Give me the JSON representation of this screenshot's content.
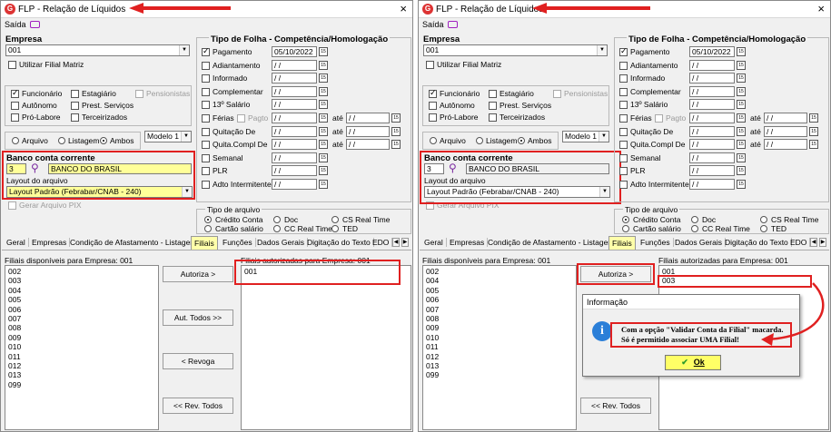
{
  "app": {
    "icon_letter": "G",
    "title": "FLP - Relação de Líquidos",
    "close": "×"
  },
  "menu": {
    "saida": "Saída"
  },
  "empresa": {
    "label": "Empresa",
    "value": "001",
    "filial_matriz": "Utilizar Filial Matriz"
  },
  "categorias": {
    "funcionario": "Funcionário",
    "estagiario": "Estagiário",
    "pensionistas": "Pensionistas",
    "autonomo": "Autônomo",
    "prest_servicos": "Prest. Serviços",
    "pro_labore": "Pró-Labore",
    "terceirizados": "Terceirizados"
  },
  "saida": {
    "arquivo": "Arquivo",
    "listagem": "Listagem",
    "ambos": "Ambos",
    "modelo": "Modelo 1"
  },
  "banco": {
    "label": "Banco conta corrente",
    "codigo": "3",
    "nome": "BANCO DO BRASIL",
    "layout_label": "Layout do arquivo",
    "layout_value": "Layout Padrão (Febrabar/CNAB - 240)",
    "pix": "Gerar Arquivo PIX"
  },
  "folha": {
    "header": "Tipo de Folha  -  Competência/Homologação",
    "rows": [
      {
        "label": "Pagamento",
        "date": "05/10/2022",
        "checked": true
      },
      {
        "label": "Adiantamento",
        "date": "/ /"
      },
      {
        "label": "Informado",
        "date": "/ /"
      },
      {
        "label": "Complementar",
        "date": "/ /"
      },
      {
        "label": "13º Salário",
        "date": "/ /"
      },
      {
        "label": "Férias",
        "date": "/ /"
      },
      {
        "label": "Quitação De",
        "date": "/ /"
      },
      {
        "label": "Quita.Compl De",
        "date": "/ /"
      },
      {
        "label": "Semanal",
        "date": "/ /"
      },
      {
        "label": "PLR",
        "date": "/ /"
      },
      {
        "label": "Adto Intermitente",
        "date": "/ /"
      }
    ],
    "pagto": "Pagto",
    "ate": "até",
    "ate_date": "/ /"
  },
  "tipo_arquivo": {
    "label": "Tipo de arquivo",
    "credito": "Crédito Conta",
    "doc": "Doc",
    "cs_real": "CS Real Time",
    "cartao": "Cartão salário",
    "cc_real": "CC Real Time",
    "ted": "TED"
  },
  "tabs": [
    "Geral",
    "Empresas",
    "Condição de Afastamento - Listagem",
    "Filiais",
    "Funções",
    "Dados Gerais",
    "Digitação do Texto",
    "EDO"
  ],
  "tab_nav": {
    "prev": "◀",
    "next": "▶"
  },
  "filiais": {
    "disponiveis_label": "Filiais disponíveis para Empresa: 001",
    "autorizadas_label": "Filiais autorizadas para Empresa: 001",
    "disponiveis": [
      "002",
      "003",
      "004",
      "005",
      "006",
      "007",
      "008",
      "009",
      "010",
      "011",
      "012",
      "013",
      "099"
    ],
    "disponiveis_right": [
      "002",
      "004",
      "005",
      "006",
      "007",
      "008",
      "009",
      "010",
      "011",
      "012",
      "013",
      "099"
    ],
    "autorizada_left": "001",
    "autorizadas_right": [
      "001",
      "003"
    ]
  },
  "buttons": {
    "autoriza": "Autoriza >",
    "aut_todos": "Aut. Todos >>",
    "revoga": "< Revoga",
    "rev_todos": "<< Rev. Todos"
  },
  "dialog": {
    "title": "Informação",
    "icon": "i",
    "msg1": "Com a opção \"Validar Conta da Filial\" macarda.",
    "msg2": "Só é permitido associar UMA Filial!",
    "ok_check": "✔",
    "ok": "Ok"
  },
  "colors": {
    "highlight": "#e02020",
    "selected_tab": "#ffffaa",
    "ok_button": "#ffff66",
    "info_icon": "#2b7fd8"
  }
}
